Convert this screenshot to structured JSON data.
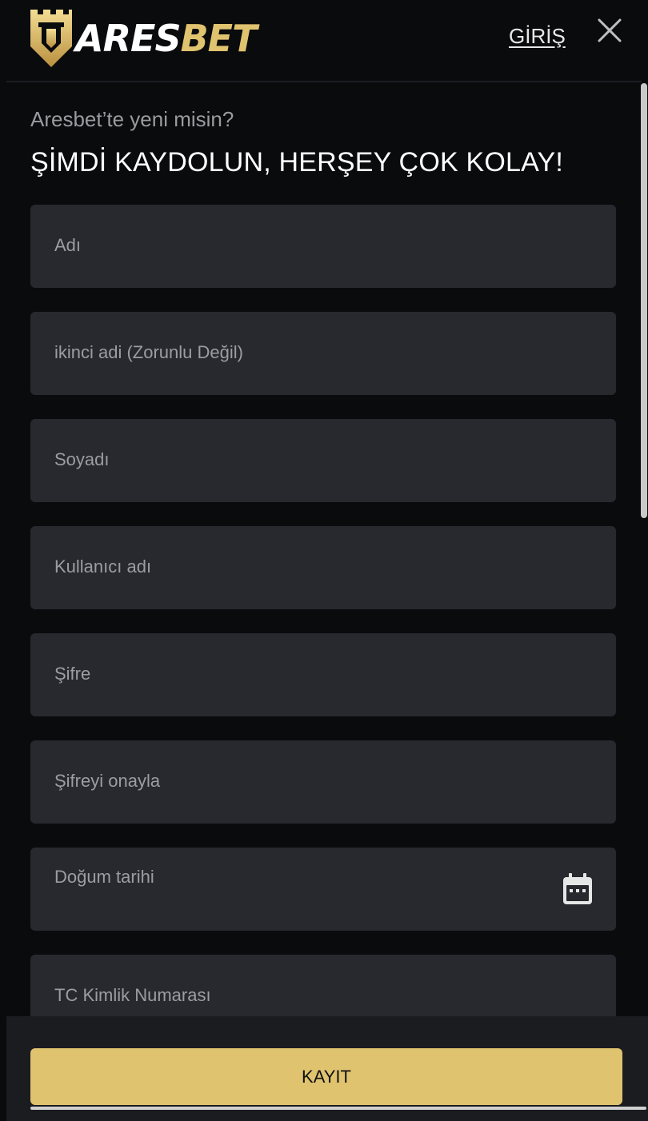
{
  "header": {
    "logo_text_1": "ARES",
    "logo_text_2": "BET",
    "login_label": "GİRİŞ",
    "close_icon": "close-icon"
  },
  "intro": {
    "subtitle": "Aresbet’te yeni misin?",
    "title": "ŞİMDİ KAYDOLUN, HERŞEY ÇOK KOLAY!"
  },
  "form": {
    "fields": [
      {
        "placeholder": "Adı"
      },
      {
        "placeholder": "ikinci adi (Zorunlu Değil)"
      },
      {
        "placeholder": "Soyadı"
      },
      {
        "placeholder": "Kullanıcı adı"
      },
      {
        "placeholder": "Şifre"
      },
      {
        "placeholder": "Şifreyi onayla"
      },
      {
        "placeholder": "Doğum tarihi",
        "icon": "calendar-icon"
      },
      {
        "placeholder": "TC Kimlik Numarası"
      }
    ],
    "submit_label": "KAYIT"
  },
  "colors": {
    "background": "#0a0b0d",
    "field_background": "#28292e",
    "accent_gold": "#e0c36f"
  }
}
